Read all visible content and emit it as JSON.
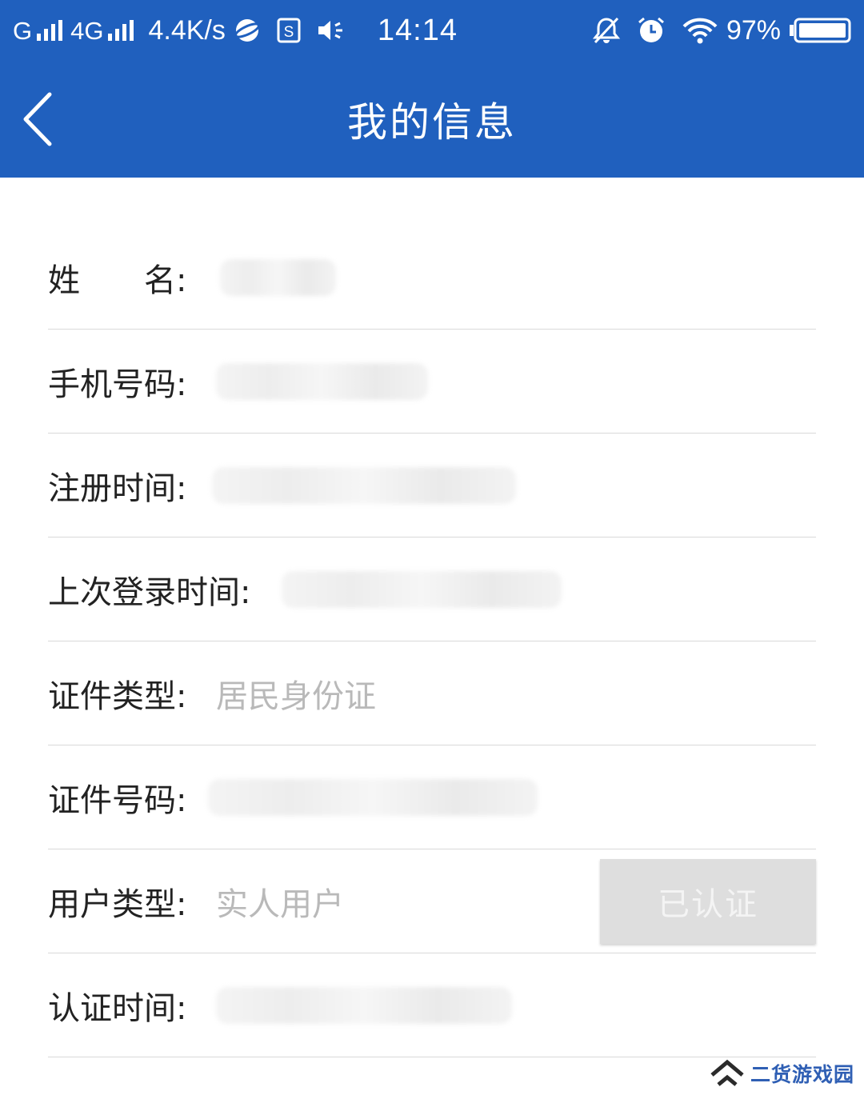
{
  "status_bar": {
    "carrier_1": "G",
    "carrier_2": "4G",
    "net_speed": "4.4K/s",
    "time": "14:14",
    "battery": "97%",
    "icons": [
      "signal-icon",
      "signal-icon",
      "browser-icon",
      "storage-icon",
      "volume-icon",
      "mute-bell-icon",
      "alarm-icon",
      "wifi-icon",
      "battery-icon"
    ]
  },
  "header": {
    "title": "我的信息",
    "back_icon": "chevron-left-icon"
  },
  "rows": [
    {
      "label": "姓　　名:",
      "value": ""
    },
    {
      "label": "手机号码:",
      "value": ""
    },
    {
      "label": "注册时间:",
      "value": ""
    },
    {
      "label": "上次登录时间:",
      "value": ""
    },
    {
      "label": "证件类型:",
      "value": "居民身份证"
    },
    {
      "label": "证件号码:",
      "value": ""
    },
    {
      "label": "用户类型:",
      "value": "实人用户",
      "button": "已认证"
    },
    {
      "label": "认证时间:",
      "value": ""
    }
  ],
  "colors": {
    "header_bg": "#2060be",
    "label": "#222222",
    "value": "#b9b9b9",
    "divider": "#d9d9d9",
    "verified_button_bg": "#dedede"
  },
  "watermark": {
    "text": "二货游戏园"
  }
}
